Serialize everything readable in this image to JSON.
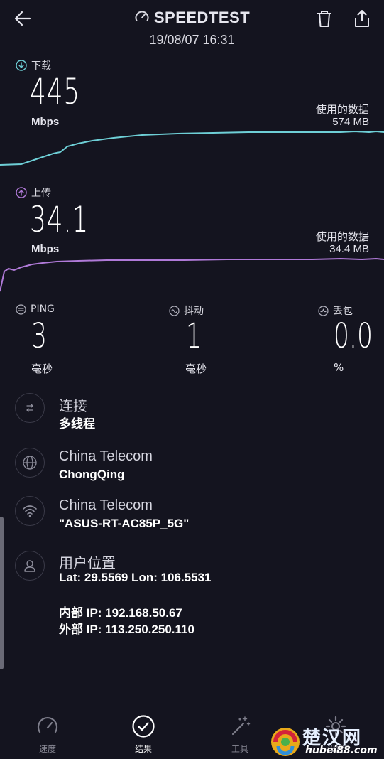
{
  "header": {
    "title": "SPEEDTEST",
    "timestamp": "19/08/07 16:31",
    "back_icon": "arrow-left-icon",
    "delete_icon": "trash-icon",
    "share_icon": "share-icon"
  },
  "download": {
    "label": "下载",
    "value": "445",
    "unit": "Mbps",
    "data_used_label": "使用的数据",
    "data_used_value": "574 MB",
    "color": "#6ecfd6"
  },
  "upload": {
    "label": "上传",
    "value": "34.1",
    "unit": "Mbps",
    "data_used_label": "使用的数据",
    "data_used_value": "34.4 MB",
    "color": "#b07ad8"
  },
  "stats": {
    "ping": {
      "label": "PING",
      "value": "3",
      "unit": "毫秒"
    },
    "jitter": {
      "label": "抖动",
      "value": "1",
      "unit": "毫秒"
    },
    "loss": {
      "label": "丢包",
      "value": "0.0",
      "unit": "%"
    }
  },
  "info": {
    "connection": {
      "title": "连接",
      "value": "多线程",
      "icon": "connection-arrows-icon"
    },
    "provider": {
      "title": "China Telecom",
      "value": "ChongQing",
      "icon": "globe-icon"
    },
    "network": {
      "title": "China Telecom",
      "value": "\"ASUS-RT-AC85P_5G\"",
      "icon": "wifi-icon"
    },
    "location": {
      "title": "用户位置",
      "value": "Lat: 29.5569 Lon: 106.5531",
      "internal_ip": "内部 IP: 192.168.50.67",
      "external_ip": "外部 IP: 113.250.250.110",
      "icon": "user-icon"
    }
  },
  "nav": {
    "items": [
      {
        "label": "速度",
        "icon": "speedometer-icon",
        "active": false
      },
      {
        "label": "结果",
        "icon": "check-circle-icon",
        "active": true
      },
      {
        "label": "工具",
        "icon": "magic-wand-icon",
        "active": false
      },
      {
        "label": "设置",
        "icon": "gear-icon",
        "active": false
      }
    ]
  },
  "watermark": {
    "text": "楚汉网",
    "sub": "hubei88.com"
  }
}
